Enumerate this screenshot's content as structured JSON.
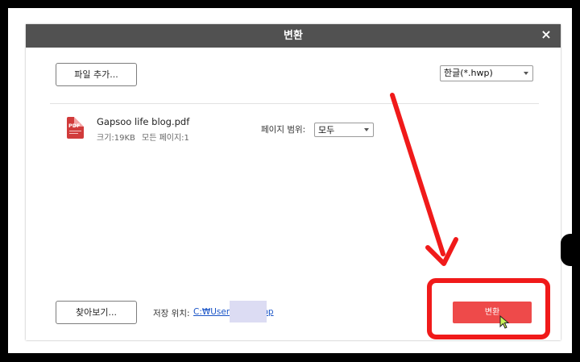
{
  "dialog": {
    "title": "변환",
    "close_symbol": "×"
  },
  "toolbar": {
    "add_file_label": "파일 추가..."
  },
  "format_select": {
    "value": "한글(*.hwp)"
  },
  "file_item": {
    "icon_text": "PDF",
    "name": "Gapsoo life blog.pdf",
    "size": "크기:19KB",
    "pages": "모든 페이지:1",
    "range_label": "페이지 범위:",
    "range_value": "모두"
  },
  "footer": {
    "browse_label": "찾아보기...",
    "save_label": "저장 위치:",
    "save_path": "C:₩Users₩                esktop",
    "convert_label": "변환"
  },
  "icons": {
    "close": "close-icon",
    "pdf": "pdf-file-icon",
    "dropdown": "chevron-down-icon",
    "cursor": "mouse-cursor-icon"
  },
  "colors": {
    "titlebar": "#515151",
    "convert_button": "#ee4a4a",
    "annotation": "#f01a1a",
    "link": "#1a54c7"
  }
}
